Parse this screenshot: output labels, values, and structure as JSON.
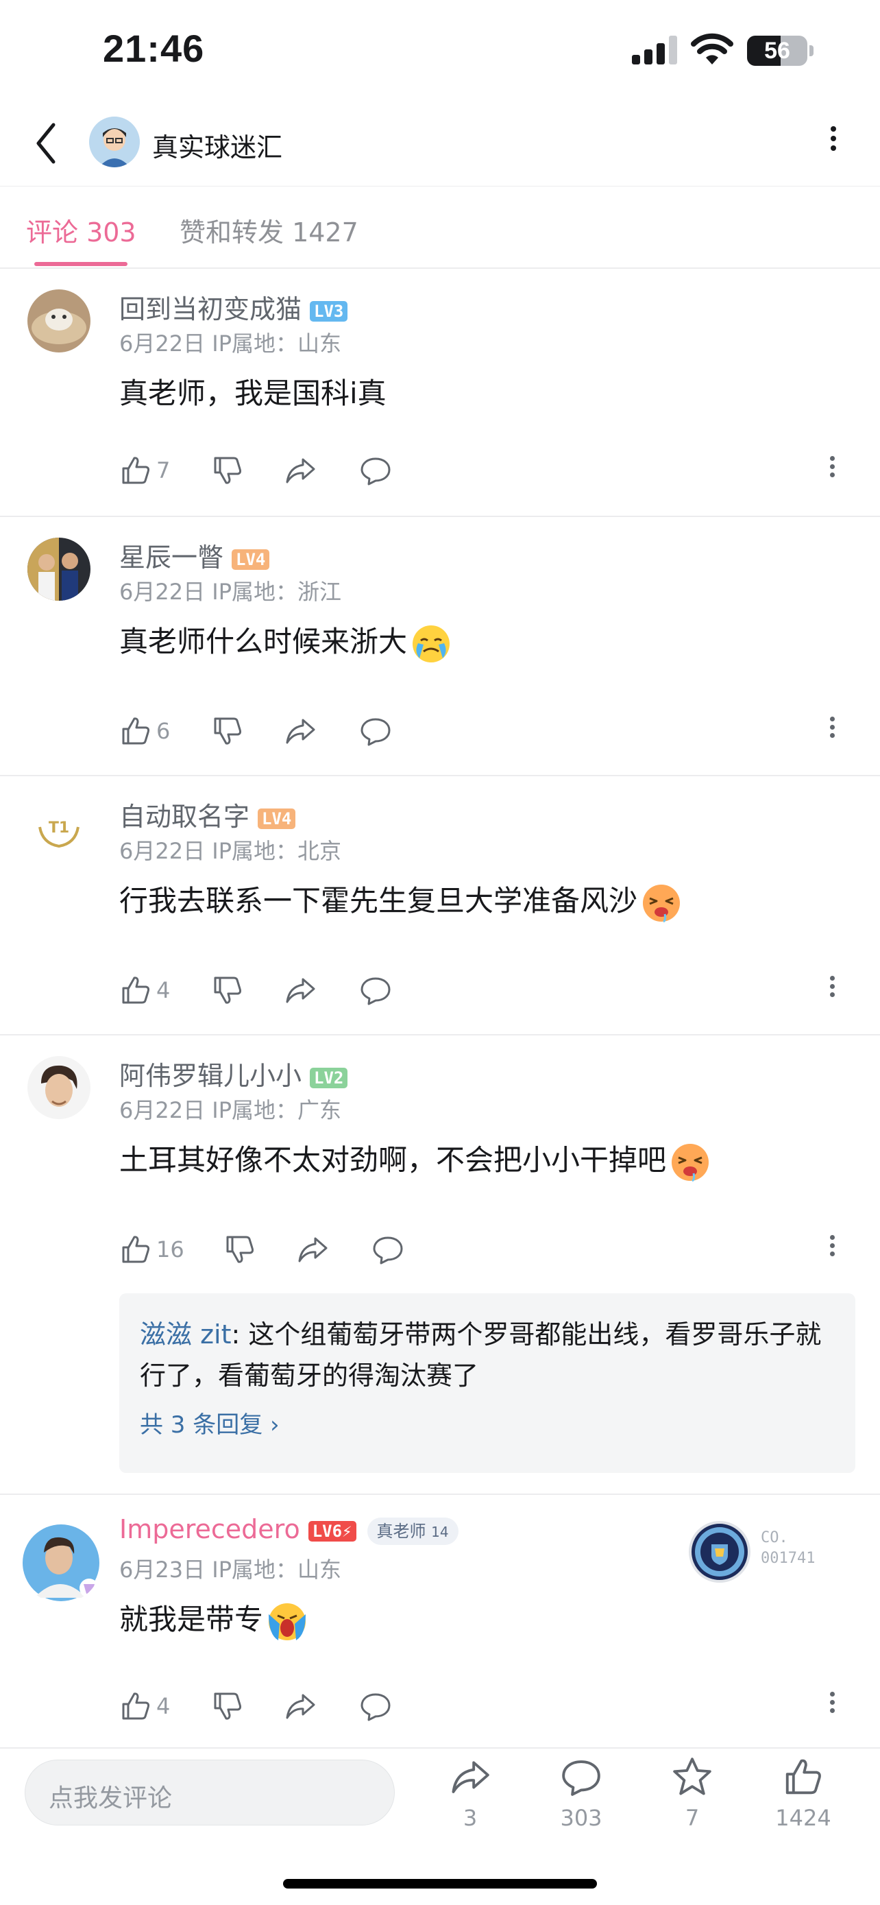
{
  "status": {
    "time": "21:46",
    "battery": "56",
    "battery_level": 0.56
  },
  "header": {
    "title": "真实球迷汇"
  },
  "tabs": {
    "comments": "评论 303",
    "likes_reposts": "赞和转发 1427"
  },
  "comments": [
    {
      "user": "回到当初变成猫",
      "level": "LV3",
      "level_color": "#64b8f0",
      "meta": "6月22日  IP属地：山东",
      "text": "真老师，我是国科i真",
      "likes": "7"
    },
    {
      "user": "星辰一瞥",
      "level": "LV4",
      "level_color": "#f7b37a",
      "meta": "6月22日  IP属地：浙江",
      "text": "真老师什么时候来浙大",
      "emoji": "crying-face",
      "likes": "6"
    },
    {
      "user": "自动取名字",
      "level": "LV4",
      "level_color": "#f7b37a",
      "meta": "6月22日  IP属地：北京",
      "text": "行我去联系一下霍先生复旦大学准备风沙",
      "emoji": "drooling-face",
      "likes": "4"
    },
    {
      "user": "阿伟罗辑儿小小",
      "level": "LV2",
      "level_color": "#8bd29a",
      "meta": "6月22日  IP属地：广东",
      "text": "土耳其好像不太对劲啊，不会把小小干掉吧",
      "emoji": "drooling-face",
      "likes": "16",
      "reply": {
        "user": "滋滋 zit",
        "text": ": 这个组葡萄牙带两个罗哥都能出线，看罗哥乐子就行了，看葡萄牙的得淘汰赛了",
        "more": "共 3 条回复 ›"
      }
    },
    {
      "user": "Imperecedero",
      "level": "LV6⚡",
      "level_color": "#f04c49",
      "tag": "真老师",
      "tag_num": "14",
      "meta": "6月23日  IP属地：山东",
      "text": "就我是带专",
      "emoji": "screaming-crying-face",
      "likes": "4",
      "fan_text_1": "CO.",
      "fan_text_2": "001741"
    }
  ],
  "bottom": {
    "placeholder": "点我发评论",
    "share": "3",
    "comments": "303",
    "favorites": "7",
    "likes": "1424"
  },
  "colors": {
    "accent": "#ec6a96",
    "link": "#3a6fa5"
  }
}
